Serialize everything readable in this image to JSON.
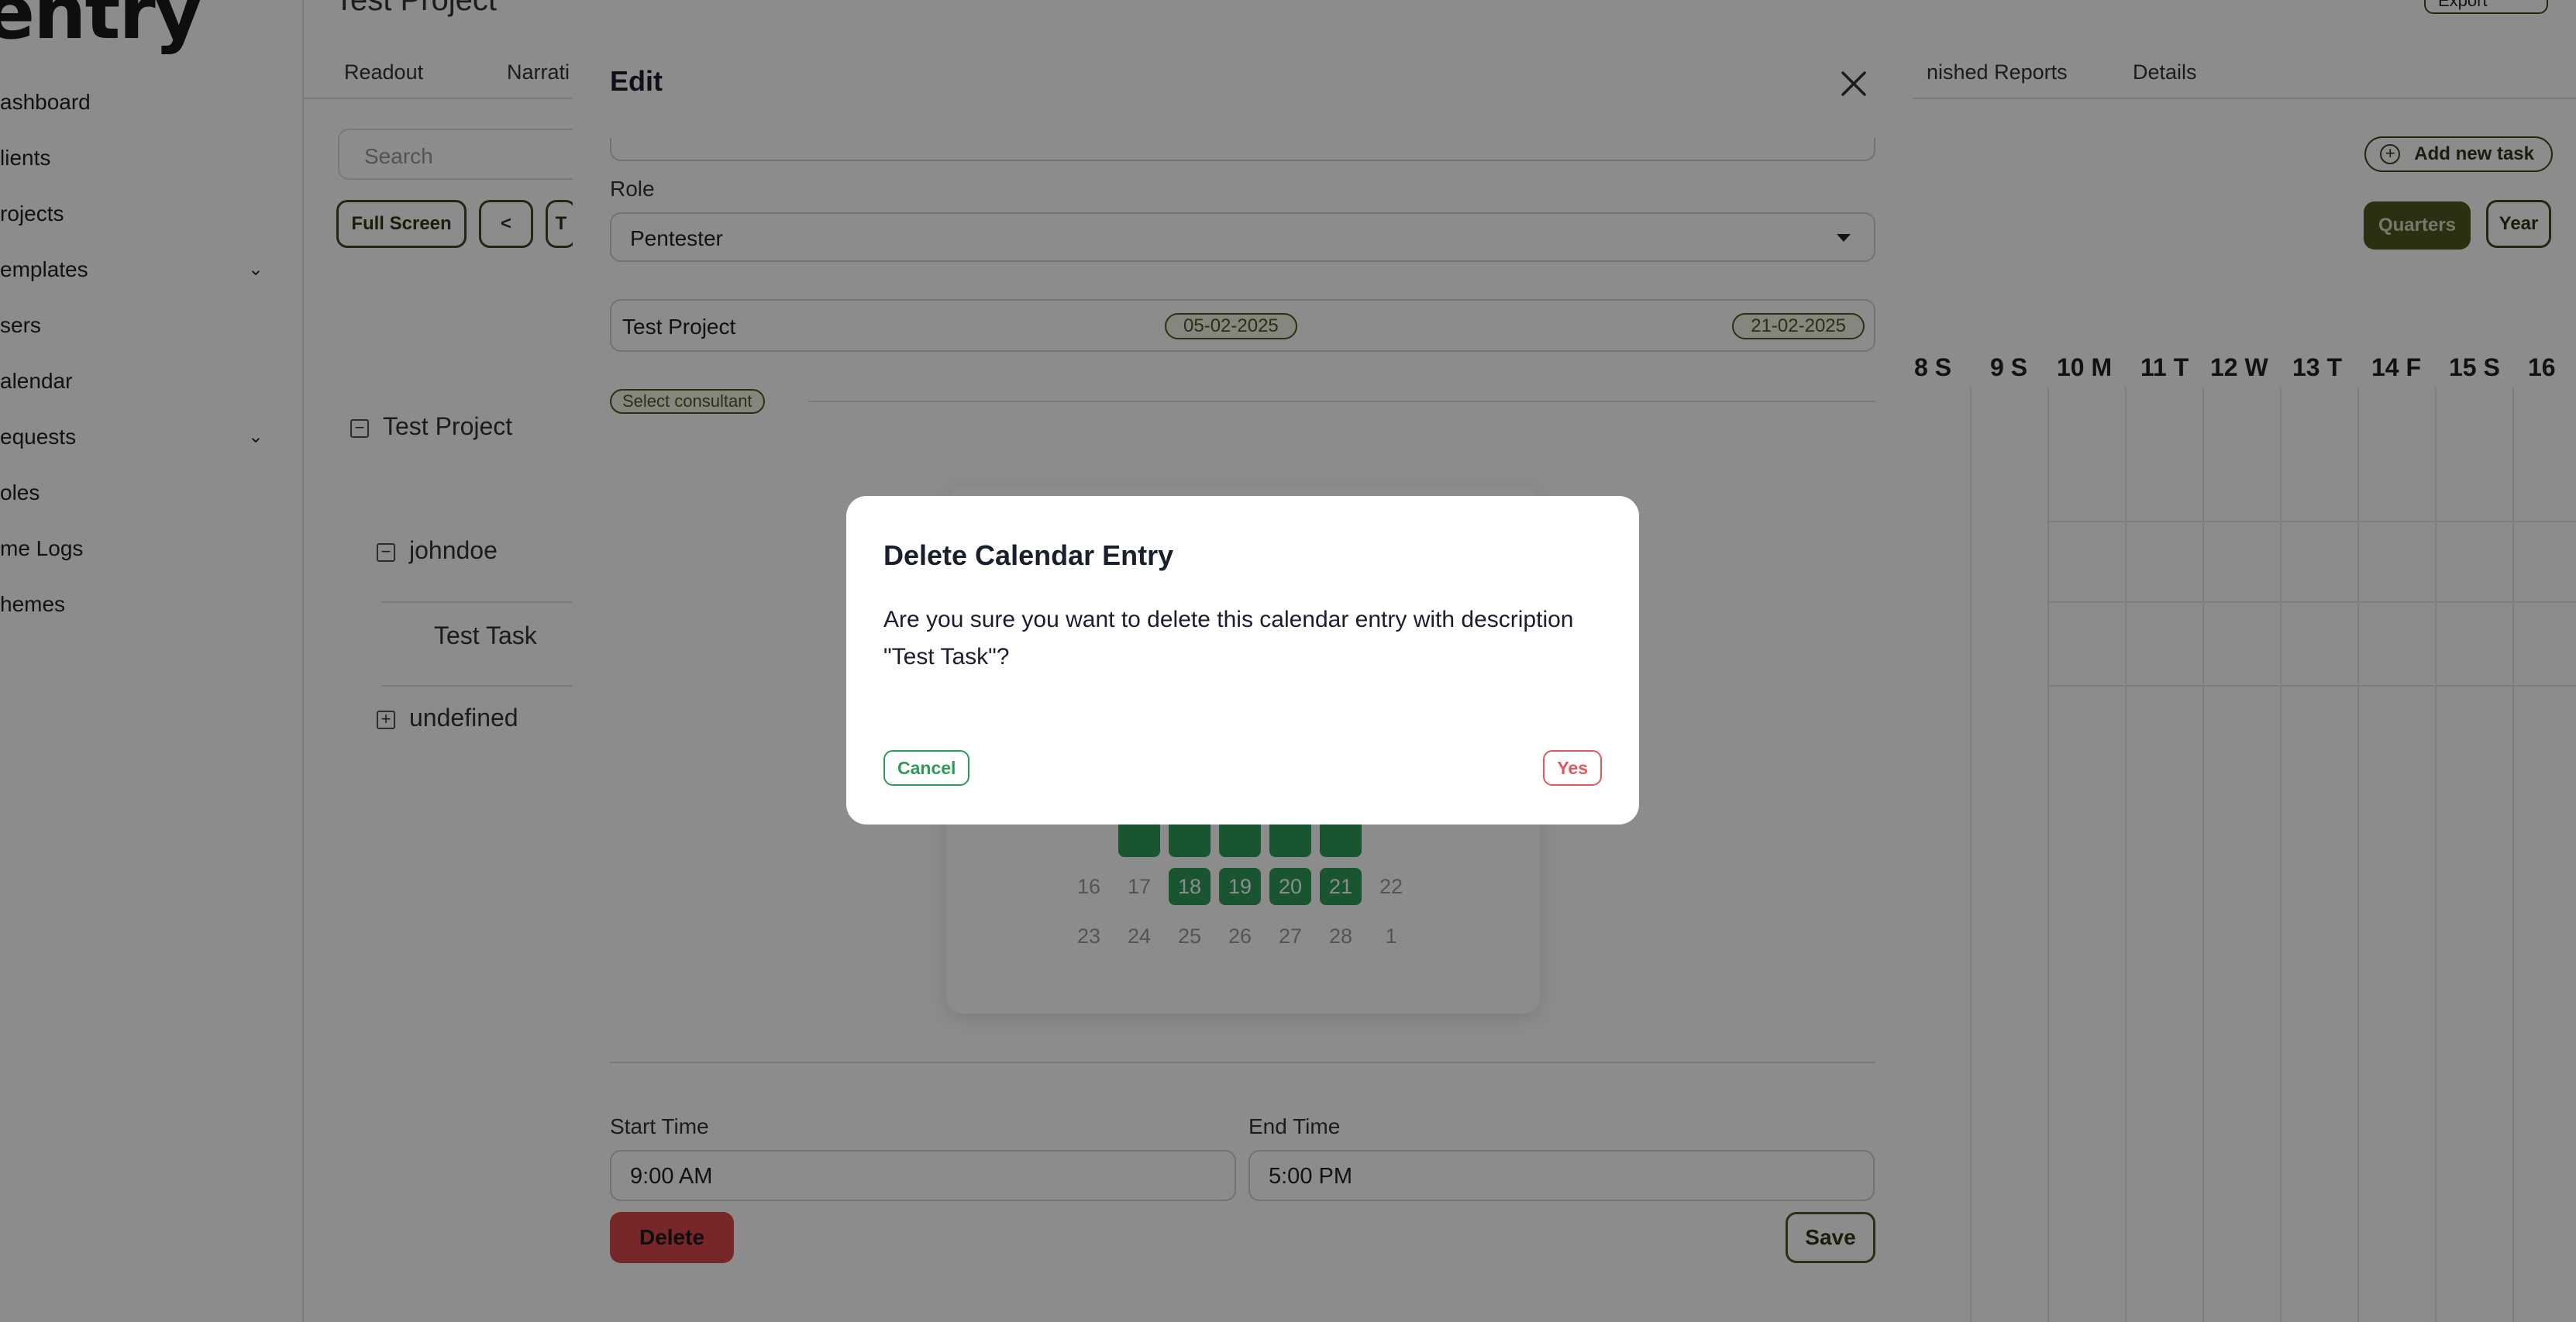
{
  "app": {
    "logo_text": "entry",
    "project_title": "Test Project",
    "export_label": "Export"
  },
  "sidebar": {
    "items": [
      {
        "label": "ashboard"
      },
      {
        "label": "lients"
      },
      {
        "label": "rojects"
      },
      {
        "label": "emplates",
        "expandable": true
      },
      {
        "label": "sers"
      },
      {
        "label": "alendar"
      },
      {
        "label": "equests",
        "expandable": true
      },
      {
        "label": "oles"
      },
      {
        "label": "me Logs"
      },
      {
        "label": "hemes"
      }
    ]
  },
  "tabs": [
    {
      "label": "Readout"
    },
    {
      "label": "Narrati"
    },
    {
      "label": "nished Reports"
    },
    {
      "label": "Details"
    }
  ],
  "toolbar": {
    "search_placeholder": "Search",
    "full_screen_label": "Full Screen",
    "prev_label": "<",
    "today_partial": "T",
    "add_task_label": "Add new task",
    "quarters_label": "Quarters",
    "year_label": "Year"
  },
  "tree": {
    "project": "Test Project",
    "user": "johndoe",
    "task": "Test Task",
    "undefined": "undefined"
  },
  "timeline_days": [
    "8 S",
    "9 S",
    "10 M",
    "11 T",
    "12 W",
    "13 T",
    "14 F",
    "15 S",
    "16"
  ],
  "edit_modal": {
    "title": "Edit",
    "role_label": "Role",
    "role_value": "Pentester",
    "project_name": "Test Project",
    "start_date": "05-02-2025",
    "end_date": "21-02-2025",
    "select_consultant_label": "Select consultant",
    "calendar": {
      "row1": [
        "",
        "",
        "",
        "",
        ""
      ],
      "row2": [
        "16",
        "17",
        "18",
        "19",
        "20",
        "21",
        "22"
      ],
      "row3": [
        "23",
        "24",
        "25",
        "26",
        "27",
        "28",
        "1"
      ]
    },
    "start_time_label": "Start Time",
    "start_time_value": "9:00 AM",
    "end_time_label": "End Time",
    "end_time_value": "5:00 PM",
    "delete_label": "Delete",
    "save_label": "Save"
  },
  "confirm_dialog": {
    "title": "Delete Calendar Entry",
    "message": "Are you sure you want to delete this calendar entry with description \"Test Task\"?",
    "cancel_label": "Cancel",
    "yes_label": "Yes"
  },
  "colors": {
    "accent_olive": "#4d5a22",
    "selected_green": "#2e9b58",
    "danger_red": "#d9484a"
  }
}
